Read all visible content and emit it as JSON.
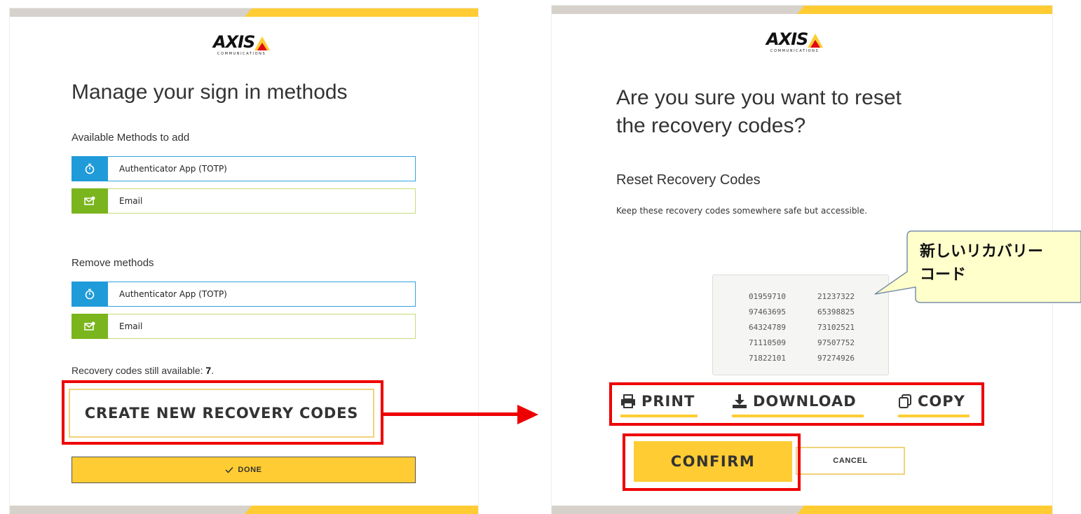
{
  "left": {
    "logo_text": "AXIS",
    "logo_subtext": "COMMUNICATIONS",
    "title": "Manage your sign in methods",
    "available_label": "Available Methods to add",
    "available_methods": [
      {
        "label": "Authenticator App (TOTP)",
        "icon": "stopwatch-icon"
      },
      {
        "label": "Email",
        "icon": "mail-icon"
      }
    ],
    "remove_label": "Remove methods",
    "remove_methods": [
      {
        "label": "Authenticator App (TOTP)",
        "icon": "stopwatch-icon"
      },
      {
        "label": "Email",
        "icon": "mail-icon"
      }
    ],
    "recovery_prefix": "Recovery codes still available: ",
    "recovery_count": "7",
    "recovery_suffix": ".",
    "create_button": "CREATE NEW RECOVERY CODES",
    "done_button": "DONE"
  },
  "right": {
    "logo_text": "AXIS",
    "logo_subtext": "COMMUNICATIONS",
    "title_line1": "Are you sure you want to reset",
    "title_line2": "the recovery codes?",
    "subtitle": "Reset Recovery Codes",
    "description": "Keep these recovery codes somewhere safe but accessible.",
    "codes": [
      [
        "01959710",
        "21237322"
      ],
      [
        "97463695",
        "65398825"
      ],
      [
        "64324789",
        "73102521"
      ],
      [
        "71110509",
        "97507752"
      ],
      [
        "71822101",
        "97274926"
      ]
    ],
    "actions": {
      "print": "PRINT",
      "download": "DOWNLOAD",
      "copy": "COPY"
    },
    "confirm_button": "CONFIRM",
    "cancel_button": "CANCEL"
  },
  "callout": {
    "line1": "新しいリカバリー",
    "line2": "コード"
  },
  "colors": {
    "brand_yellow": "#ffcc33",
    "annotation_red": "#ee0000",
    "method_blue": "#1f9bd9",
    "method_green": "#7ab51d",
    "callout_fill": "#ffffcc",
    "band_gray": "#d6d1cb"
  }
}
